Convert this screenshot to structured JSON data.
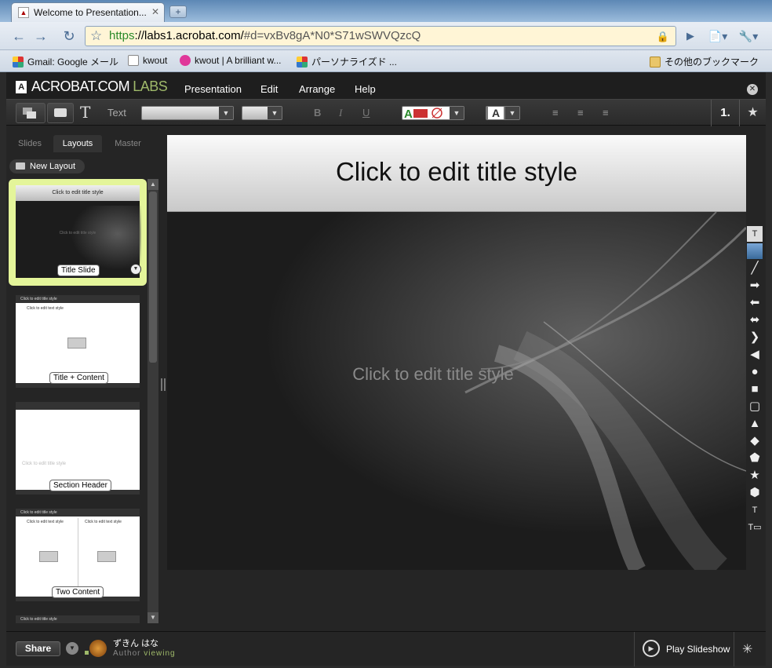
{
  "browser": {
    "tab_title": "Welcome to Presentation...",
    "tab_close": "✕",
    "new_tab": "+",
    "url_https": "https",
    "url_host": "://labs1.acrobat.com/",
    "url_rest": "#d=vxBv8gA*N0*S71wSWVQzcQ",
    "bookmarks": [
      {
        "label": "Gmail: Google メール",
        "color": "#d33"
      },
      {
        "label": "kwout",
        "color": "#fff"
      },
      {
        "label": "kwout | A brilliant w...",
        "color": "#e0389a"
      },
      {
        "label": "パーソナライズド ...",
        "color": "#3a7"
      },
      {
        "label": "その他のブックマーク",
        "color": "#e9c66a"
      }
    ]
  },
  "app": {
    "logo_main": "ACROBAT.COM",
    "logo_labs": "LABS",
    "menus": [
      "Presentation",
      "Edit",
      "Arrange",
      "Help"
    ],
    "toolbar": {
      "text_label": "Text",
      "bold": "B",
      "italic": "I",
      "underline": "U",
      "numbered": "1."
    },
    "panel_tabs": [
      "Slides",
      "Layouts",
      "Master"
    ],
    "new_layout": "New Layout",
    "layouts": [
      {
        "label": "Title Slide",
        "title": "Click to edit title style",
        "sub": "Click to edit title style"
      },
      {
        "label": "Title + Content",
        "title": "Click to edit title style",
        "sub": "Click to edit text style"
      },
      {
        "label": "Section Header",
        "title": "",
        "sub": "Click to edit title style"
      },
      {
        "label": "Two Content",
        "title": "Click to edit title style",
        "sub": "Click to edit text style"
      },
      {
        "label": "",
        "title": "Click to edit title style",
        "sub": ""
      }
    ],
    "slide": {
      "title": "Click to edit title style",
      "subtitle": "Click to edit title style"
    },
    "bottom": {
      "share": "Share",
      "user_name": "ずきん はな",
      "role": "Author",
      "status": "viewing",
      "play": "Play Slideshow"
    }
  }
}
